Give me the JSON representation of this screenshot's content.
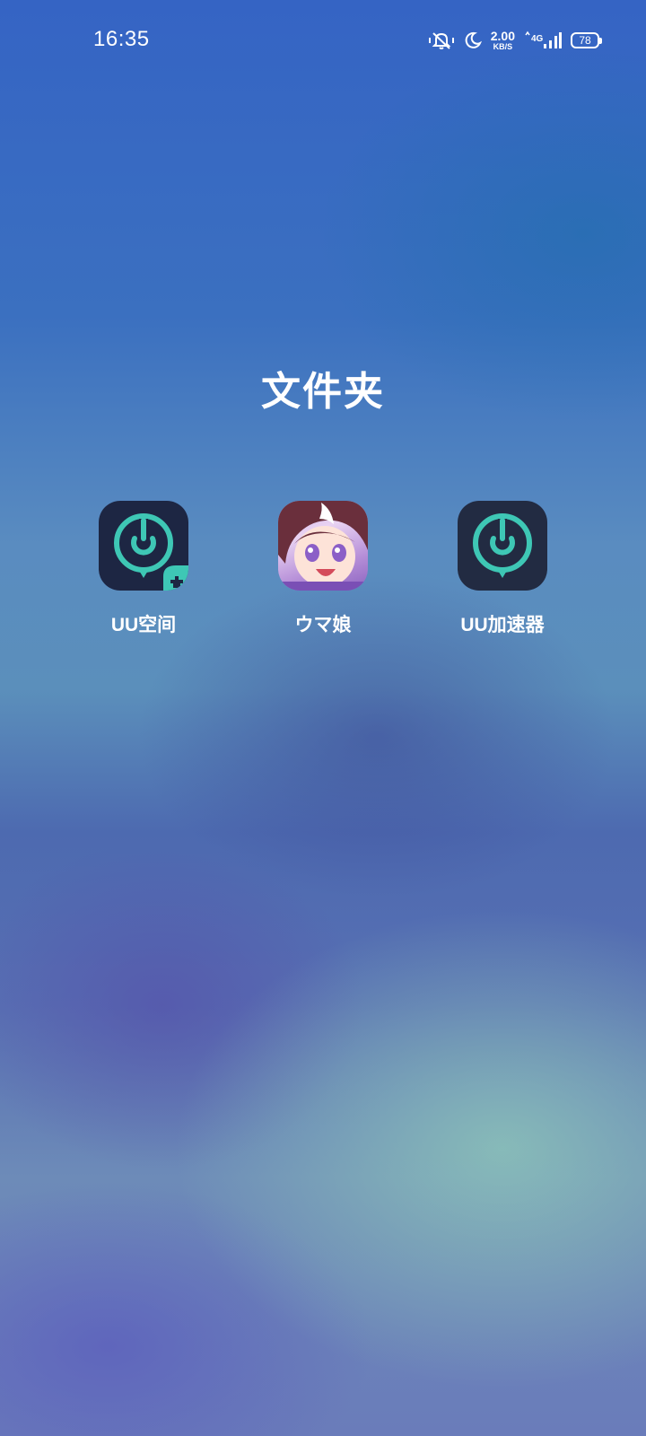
{
  "status_bar": {
    "time": "16:35",
    "net_speed_value": "2.00",
    "net_speed_unit": "KB/S",
    "network_type": "4G",
    "battery_percent": "78"
  },
  "folder": {
    "title": "文件夹",
    "apps": [
      {
        "label": "UU空间",
        "icon": "uu-space-icon"
      },
      {
        "label": "ウマ娘",
        "icon": "uma-musume-icon"
      },
      {
        "label": "UU加速器",
        "icon": "uu-accelerator-icon"
      }
    ]
  },
  "colors": {
    "uu_icon_background": "#1d2643",
    "uu_icon_accent": "#3ec7b5"
  }
}
